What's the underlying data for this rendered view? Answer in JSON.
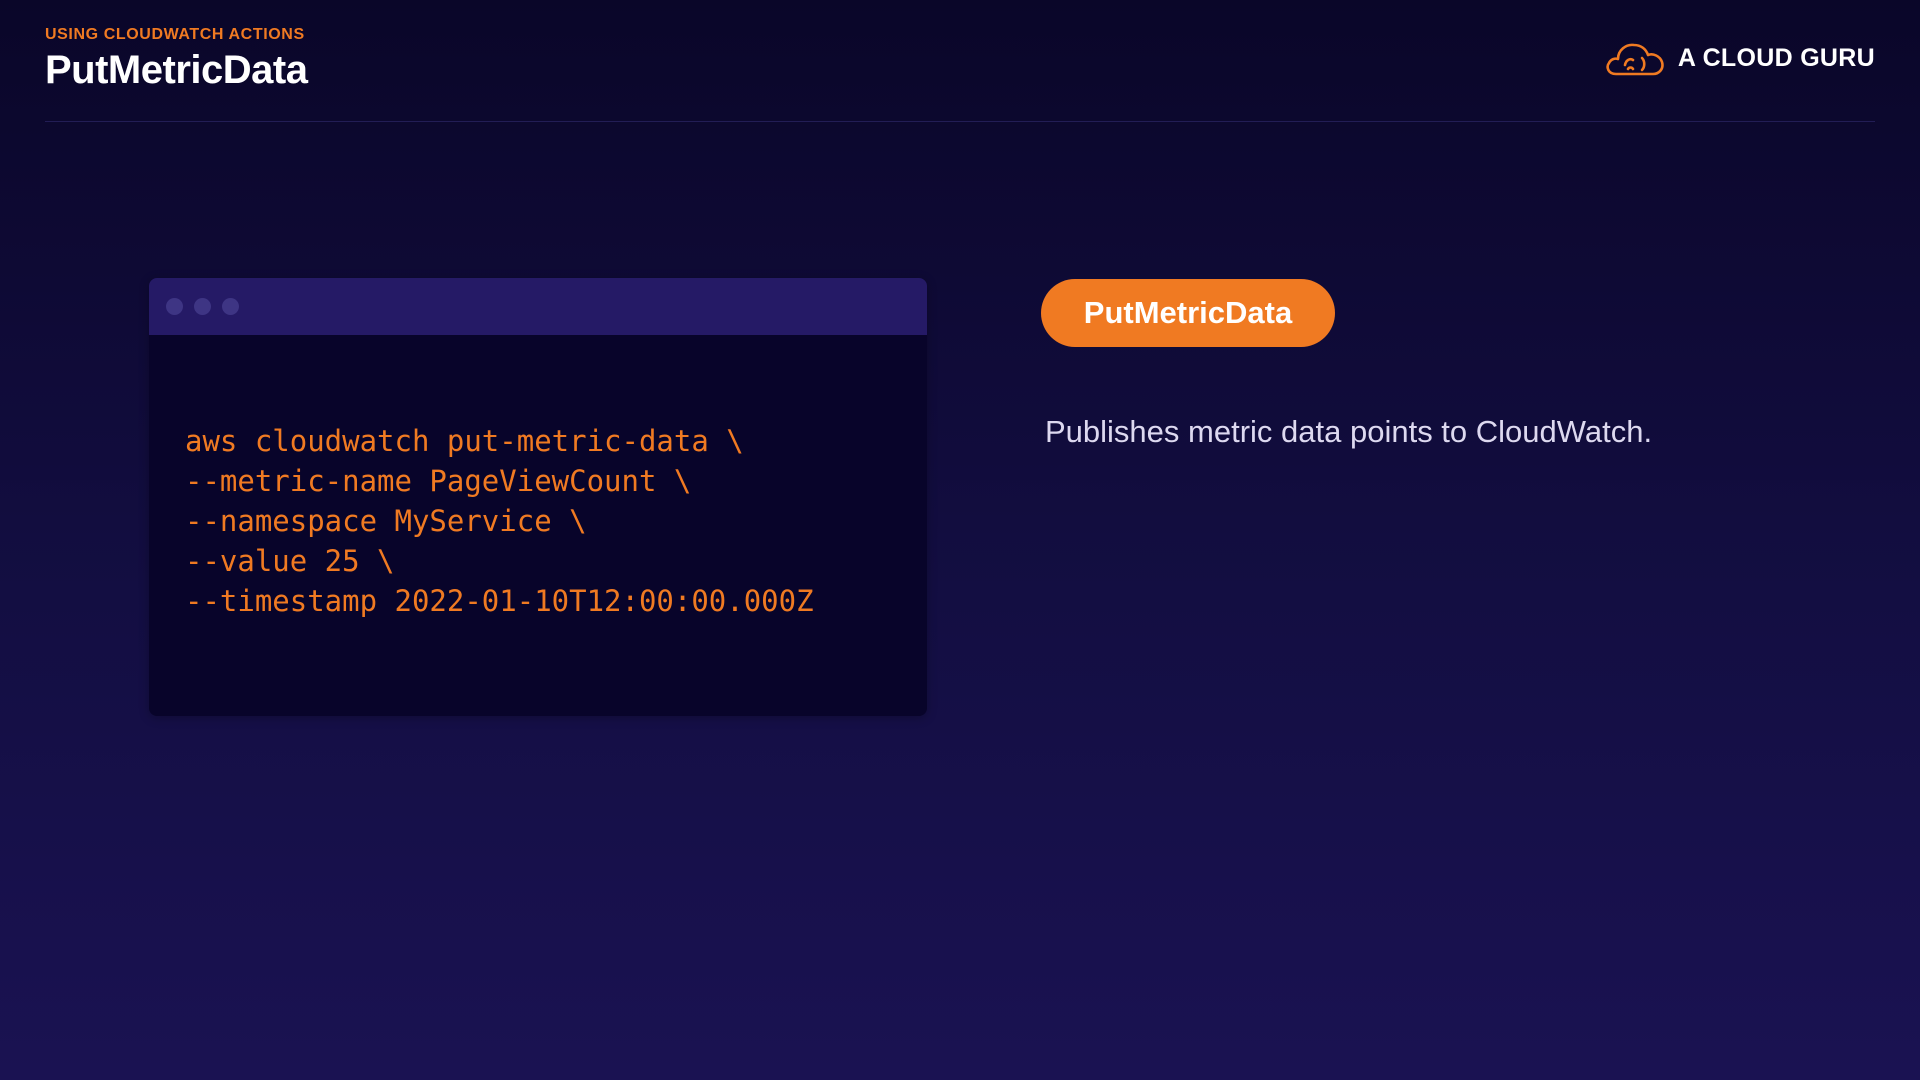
{
  "header": {
    "section_label": "USING CLOUDWATCH ACTIONS",
    "title": "PutMetricData",
    "brand": {
      "name": "A CLOUD GURU",
      "icon": "cloud-logo-icon"
    }
  },
  "terminal": {
    "window_dots": [
      "dot",
      "dot",
      "dot"
    ],
    "code_lines": [
      "aws cloudwatch put-metric-data \\",
      "--metric-name PageViewCount \\",
      "--namespace MyService \\",
      "--value 25 \\",
      "--timestamp 2022-01-10T12:00:00.000Z"
    ]
  },
  "info": {
    "pill_label": "PutMetricData",
    "description": "Publishes metric data points to CloudWatch."
  },
  "colors": {
    "accent": "#f07a22",
    "background_top": "#0a0629",
    "background_bottom": "#1a1252",
    "terminal_bar": "#251a66",
    "terminal_body": "#08042a"
  }
}
